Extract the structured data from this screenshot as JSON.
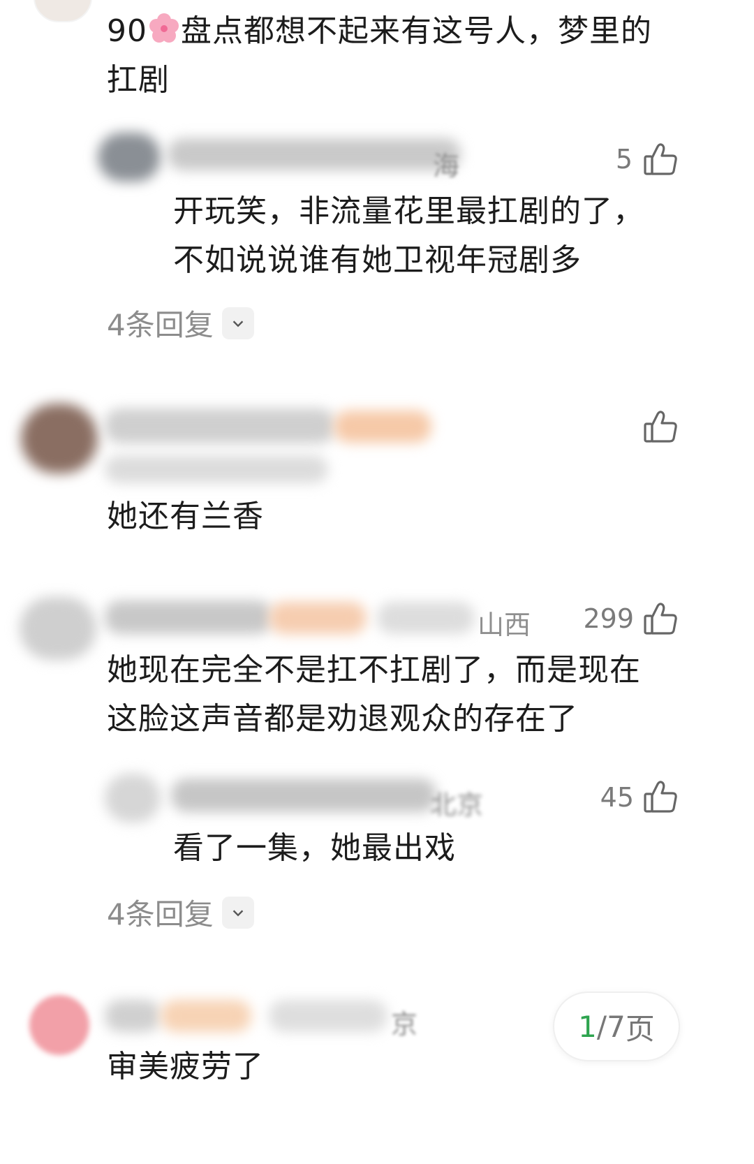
{
  "comments": [
    {
      "text_before": "90",
      "text_after": "盘点都想不起来有这号人，梦里的扛剧",
      "sub_reply": {
        "location": "海",
        "likes": "5",
        "text": "开玩笑，非流量花里最扛剧的了，不如说说谁有她卫视年冠剧多"
      },
      "more_replies": "4条回复"
    },
    {
      "text": "她还有兰香"
    },
    {
      "location": "山西",
      "likes": "299",
      "text": "她现在完全不是扛不扛剧了，而是现在这脸这声音都是劝退观众的存在了",
      "sub_reply": {
        "location": "北京",
        "likes": "45",
        "text": "看了一集，她最出戏"
      },
      "more_replies": "4条回复"
    },
    {
      "location": "京",
      "text": "审美疲劳了"
    }
  ],
  "pager": {
    "current": "1",
    "separator": "/",
    "total": "7",
    "suffix": "页"
  },
  "icons": {
    "like": "thumbs-up-icon",
    "expand": "chevron-down-icon",
    "emoji": "cherry-blossom-icon"
  },
  "colors": {
    "accent": "#2ea44f",
    "muted": "#8c8c8c"
  }
}
